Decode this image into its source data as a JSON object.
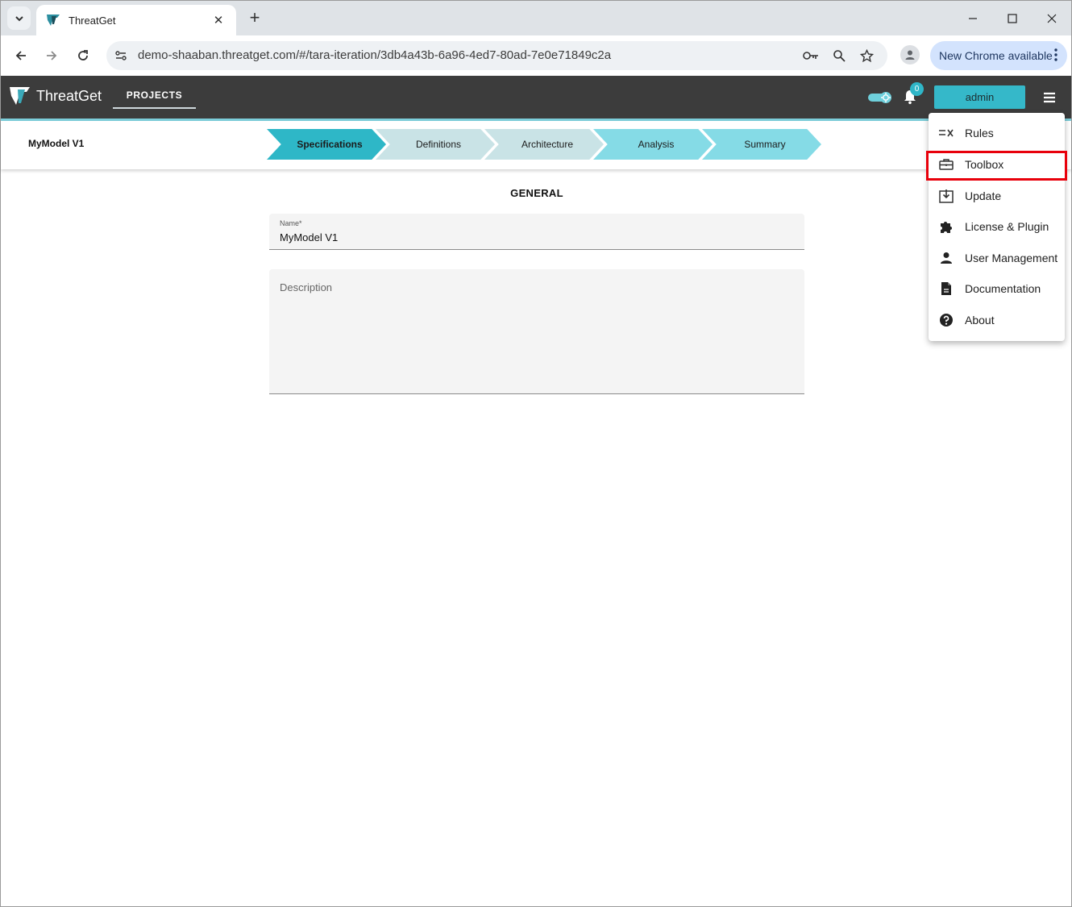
{
  "browser": {
    "tab_title": "ThreatGet",
    "url": "demo-shaaban.threatget.com/#/tara-iteration/3db4a43b-6a96-4ed7-80ad-7e0e71849c2a",
    "update_label": "New Chrome available"
  },
  "app": {
    "brand": "ThreatGet",
    "nav_projects": "PROJECTS",
    "notification_count": "0",
    "user_button": "admin",
    "accent_color": "#35b8c9"
  },
  "stepper": {
    "model_title": "MyModel V1",
    "steps": [
      {
        "label": "Specifications",
        "color": "#2eb7c7"
      },
      {
        "label": "Definitions",
        "color": "#c9e3e6"
      },
      {
        "label": "Architecture",
        "color": "#c9e3e6"
      },
      {
        "label": "Analysis",
        "color": "#85dbe6"
      },
      {
        "label": "Summary",
        "color": "#85dbe6"
      }
    ]
  },
  "form": {
    "section_title": "GENERAL",
    "name_label": "Name*",
    "name_value": "MyModel V1",
    "description_placeholder": "Description"
  },
  "menu": {
    "items": [
      {
        "label": "Rules",
        "icon": "rules-icon"
      },
      {
        "label": "Toolbox",
        "icon": "toolbox-icon"
      },
      {
        "label": "Update",
        "icon": "update-icon"
      },
      {
        "label": "License & Plugin",
        "icon": "puzzle-icon"
      },
      {
        "label": "User Management",
        "icon": "person-icon"
      },
      {
        "label": "Documentation",
        "icon": "document-icon"
      },
      {
        "label": "About",
        "icon": "help-icon"
      }
    ],
    "highlighted": "Toolbox",
    "highlight_color": "#e8000b"
  }
}
